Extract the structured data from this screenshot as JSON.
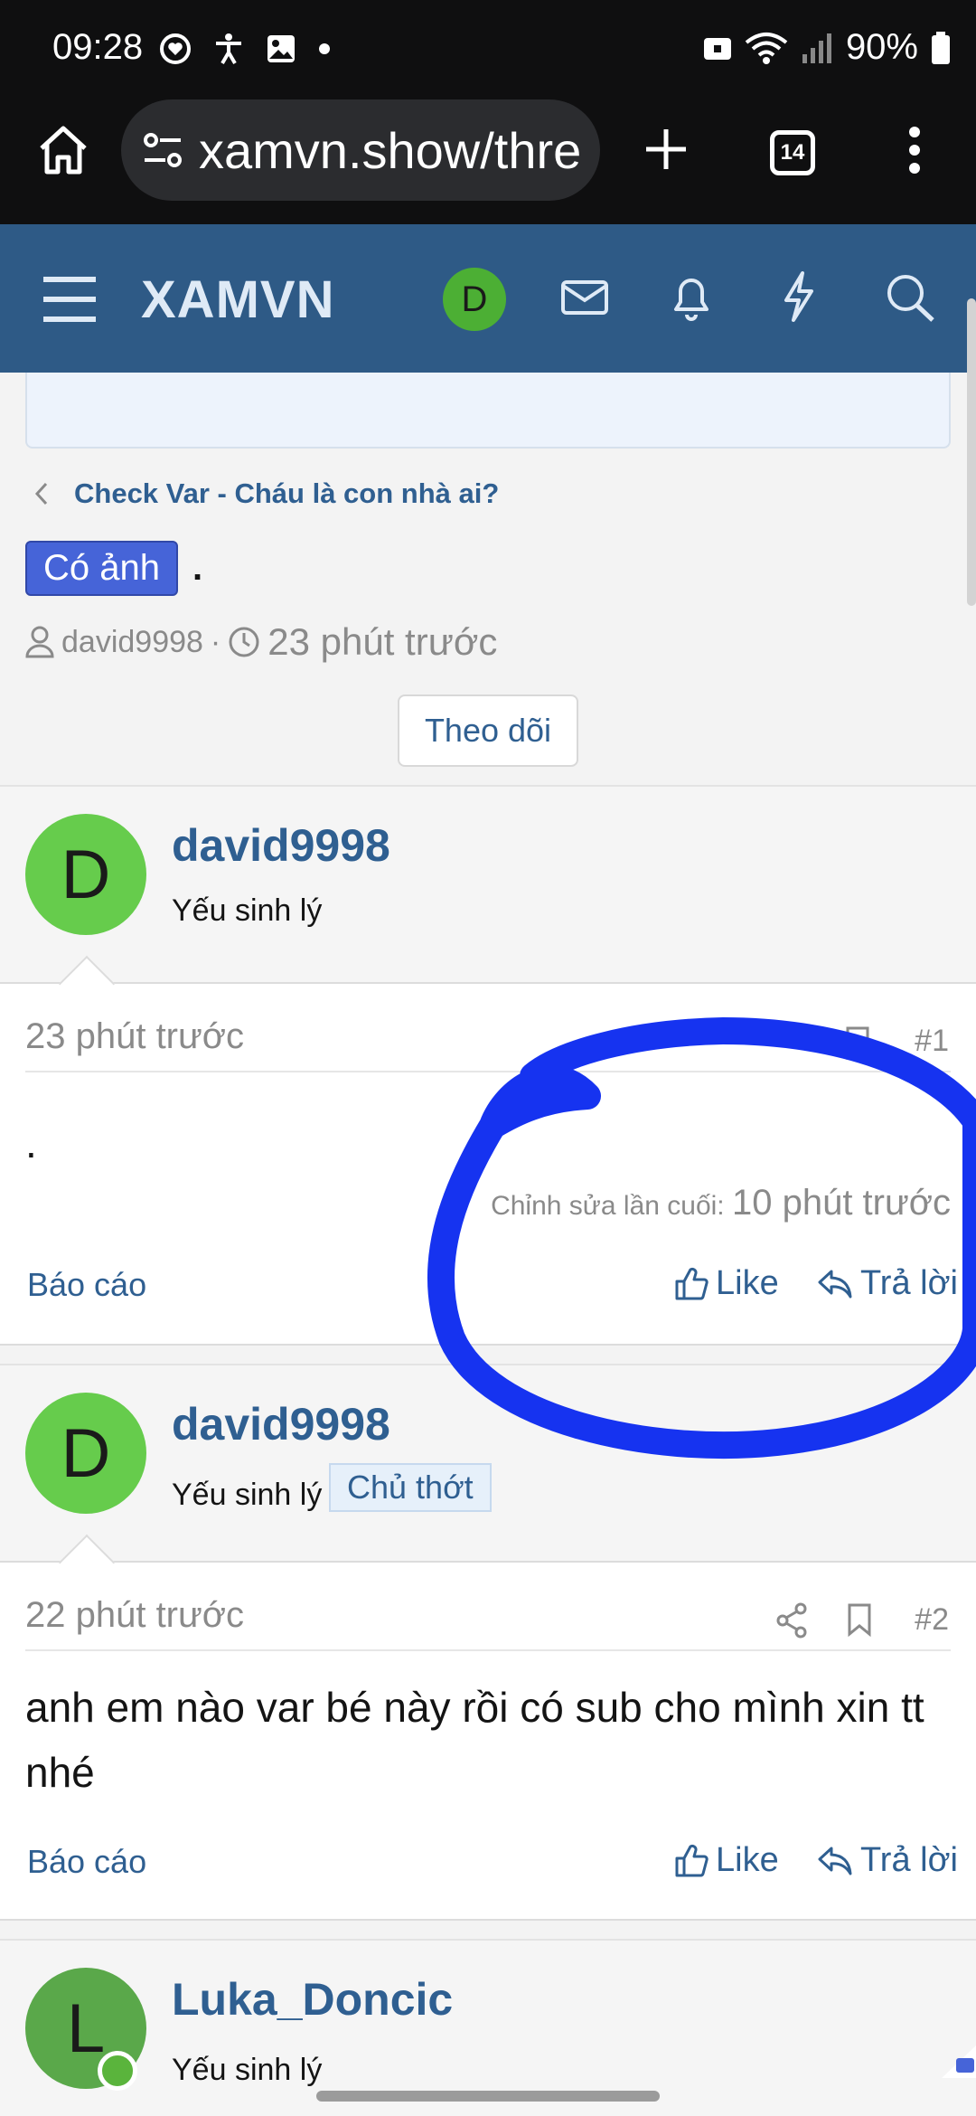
{
  "status_bar": {
    "time": "09:28",
    "battery": "90%"
  },
  "browser": {
    "url": "xamvn.show/thre",
    "tab_count": "14"
  },
  "site": {
    "logo": "XAMVN",
    "user_initial": "D"
  },
  "breadcrumb": "Check Var - Cháu là con nhà ai?",
  "thread": {
    "prefix": "Có ảnh",
    "title": ".",
    "author": "david9998",
    "separator": "·",
    "time": "23 phút trước",
    "follow_label": "Theo dõi"
  },
  "posts": [
    {
      "initial": "D",
      "username": "david9998",
      "user_title": "Yếu sinh lý",
      "time": "23 phút trước",
      "number": "#1",
      "text": ".",
      "edited_label": "Chỉnh sửa lần cuối:",
      "edited_time": "10 phút trước",
      "report": "Báo cáo",
      "like": "Like",
      "reply": "Trả lời"
    },
    {
      "initial": "D",
      "username": "david9998",
      "user_title": "Yếu sinh lý",
      "badge": "Chủ thớt",
      "time": "22 phút trước",
      "number": "#2",
      "text": "anh em nào var bé này rồi có sub cho mình xin tt nhé",
      "report": "Báo cáo",
      "like": "Like",
      "reply": "Trả lời"
    },
    {
      "initial": "L",
      "username": "Luka_Doncic",
      "user_title": "Yếu sinh lý"
    }
  ],
  "colors": {
    "header": "#2e5a86",
    "link": "#2f5f91",
    "annotation": "#1633f0",
    "prefix_badge": "#4664d8"
  }
}
